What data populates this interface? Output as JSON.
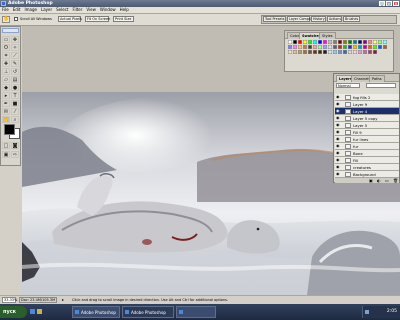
{
  "window": {
    "title": "Adobe Photoshop",
    "controls": [
      "_",
      "□",
      "×"
    ]
  },
  "menus": [
    "File",
    "Edit",
    "Image",
    "Layer",
    "Select",
    "Filter",
    "View",
    "Window",
    "Help"
  ],
  "options_bar": {
    "checkbox_label": "Scroll All Windows",
    "buttons": [
      "Actual Pixels",
      "Fit On Screen",
      "Print Size"
    ],
    "palette_well_tabs": [
      "Tool Presets",
      "Layer Comps",
      "History",
      "Actions",
      "Brushes"
    ]
  },
  "swatches_panel": {
    "tabs": [
      "Color",
      "Swatches",
      "Styles"
    ],
    "active_tab": "Swatches",
    "colors": [
      "#ffffff",
      "#000000",
      "#ff0000",
      "#ffff00",
      "#00ff00",
      "#00ffff",
      "#0000ff",
      "#ff00ff",
      "#c0c0c0",
      "#808080",
      "#800000",
      "#808000",
      "#008000",
      "#008080",
      "#000080",
      "#800080",
      "#ff8080",
      "#ffff80",
      "#80ff80",
      "#80ffff",
      "#8080ff",
      "#ff80ff",
      "#ffc080",
      "#c08040",
      "#404040",
      "#ffa0a0",
      "#a0ffa0",
      "#a0a0ff",
      "#e0e0e0",
      "#606060",
      "#b03030",
      "#30b030",
      "#3030b0",
      "#f0c000",
      "#00a0c0",
      "#c000a0",
      "#f06000",
      "#60f000",
      "#0060f0",
      "#a06030",
      "#f4e4c0",
      "#d8c098",
      "#b89868",
      "#987048",
      "#785030",
      "#583818",
      "#402810",
      "#281808",
      "#c8e8f8",
      "#98c8e8",
      "#6898c8",
      "#3868a8",
      "#1838788",
      "#f8d0e0",
      "#e0a0c0",
      "#c07098",
      "#a04070",
      "#801850"
    ]
  },
  "layers_panel": {
    "tabs": [
      "Layers",
      "Channels",
      "Paths"
    ],
    "active_tab": "Layers",
    "blend_mode": "Normal",
    "layers": [
      {
        "name": "fog fills 2",
        "visible": true,
        "selected": false
      },
      {
        "name": "Layer 9",
        "visible": true,
        "selected": false
      },
      {
        "name": "Layer 4",
        "visible": true,
        "selected": true
      },
      {
        "name": "Layer 5 copy",
        "visible": true,
        "selected": false
      },
      {
        "name": "Layer 5",
        "visible": true,
        "selected": false
      },
      {
        "name": "Fill 9",
        "visible": true,
        "selected": false
      },
      {
        "name": "fur lines",
        "visible": true,
        "selected": false
      },
      {
        "name": "fur",
        "visible": true,
        "selected": false
      },
      {
        "name": "Bone",
        "visible": true,
        "selected": false
      },
      {
        "name": "Fill",
        "visible": true,
        "selected": false
      },
      {
        "name": "creatures",
        "visible": true,
        "selected": false
      },
      {
        "name": "Background",
        "visible": true,
        "selected": false
      }
    ]
  },
  "status_bar": {
    "zoom": "33.33%",
    "doc_info": "Doc: 23.4M/105.3M",
    "hint": "Click and drag to scroll image in desired direction. Use Alt and Ctrl for additional options."
  },
  "taskbar": {
    "start_label": "пуск",
    "tasks": [
      "Adobe Photoshop",
      "Adobe Photoshop",
      ""
    ],
    "clock": "2:05"
  },
  "colors": {
    "foreground": "#000000",
    "background": "#ffffff",
    "selected_layer": "#1b2f6c"
  }
}
